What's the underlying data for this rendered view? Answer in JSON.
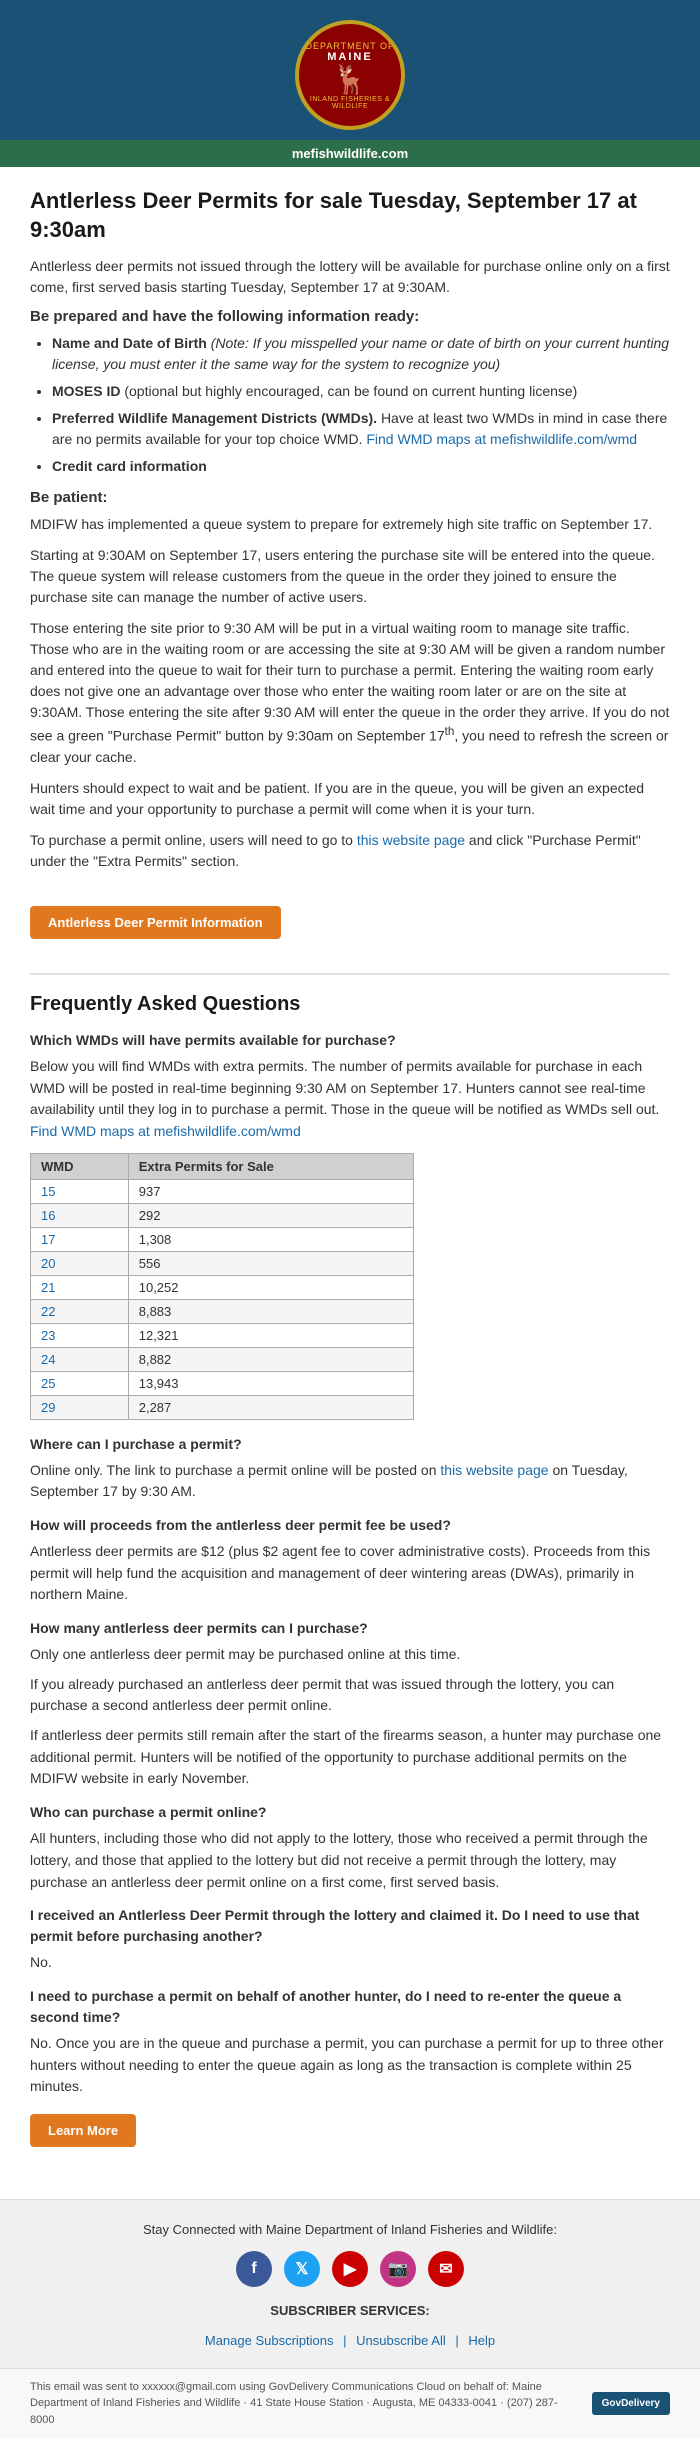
{
  "header": {
    "logo_top_text": "MAINE",
    "logo_arc_top": "DEPARTMENT OF",
    "logo_arc_bottom": "INLAND FISHERIES & WILDLIFE",
    "url_bar": "mefishwildlife.com"
  },
  "main": {
    "page_title": "Antlerless Deer Permits for sale Tuesday, September 17 at 9:30am",
    "intro_paragraph": "Antlerless deer permits not issued through the lottery will be available for purchase online only on a first come, first served basis starting Tuesday, September 17 at 9:30AM.",
    "be_prepared_heading": "Be prepared and have the following information ready:",
    "info_list": [
      {
        "label": "Name and Date of Birth",
        "note": "(Note: If you misspelled your name or date of birth on your current hunting license, you must enter it the same way for the system to recognize you)"
      },
      {
        "label": "MOSES ID",
        "note": "(optional but highly encouraged, can be found on current hunting license)"
      },
      {
        "label": "Preferred Wildlife Management Districts (WMDs).",
        "note": "Have at least two WMDs in mind in case there are no permits available for your top choice WMD.",
        "link_text": "Find WMD maps at mefishwildlife.com/wmd",
        "link_href": "#"
      },
      {
        "label": "Credit card information"
      }
    ],
    "be_patient_heading": "Be patient:",
    "be_patient_paragraphs": [
      "MDIFW has implemented a queue system to prepare for extremely high site traffic on September 17.",
      "Starting at 9:30AM on September 17, users entering the purchase site will be entered into the queue. The queue system will release customers from the queue in the order they joined to ensure the purchase site can manage the number of active users.",
      "Those entering the site prior to 9:30 AM will be put in a virtual waiting room to manage site traffic. Those who are in the waiting room or are accessing the site at 9:30 AM will be given a random number and entered into the queue to wait for their turn to purchase a permit. Entering the waiting room early does not give one an advantage over those who enter the waiting room later or are on the site at 9:30AM. Those entering the site after 9:30 AM will enter the queue in the order they arrive. If you do not see a green \"Purchase Permit\" button by 9:30am on September 17th, you need to refresh the screen or clear your cache.",
      "Hunters should expect to wait and be patient. If you are in the queue, you will be given an expected wait time and your opportunity to purchase a permit will come when it is your turn.",
      "To purchase a permit online, users will need to go to this website page and click \"Purchase Permit\" under the \"Extra Permits\" section."
    ],
    "btn_permit_info": "Antlerless Deer Permit Information",
    "faq_heading": "Frequently Asked Questions",
    "faqs": [
      {
        "question": "Which WMDs will have permits available for purchase?",
        "answer": "Below you will find WMDs with extra permits. The number of permits available for purchase in each WMD will be posted in real-time beginning 9:30 AM on September 17. Hunters cannot see real-time availability until they log in to purchase a permit. Those in the queue will be notified as WMDs sell out.",
        "link_text": "Find WMD maps at mefishwildlife.com/wmd",
        "link_href": "#",
        "has_table": true
      },
      {
        "question": "Where can I purchase a permit?",
        "answer": "Online only. The link to purchase a permit online will be posted on this website page on Tuesday, September 17 by 9:30 AM."
      },
      {
        "question": "How will proceeds from the antlerless deer permit fee be used?",
        "answer": "Antlerless deer permits are $12 (plus $2 agent fee to cover administrative costs). Proceeds from this permit will help fund the acquisition and management of deer wintering areas (DWAs), primarily in northern Maine."
      },
      {
        "question": "How many antlerless deer permits can I purchase?",
        "answer": "Only one antlerless deer permit may be purchased online at this time.",
        "answer2": "If you already purchased an antlerless deer permit that was issued through the lottery, you can purchase a second antlerless deer permit online.",
        "answer3": "If antlerless deer permits still remain after the start of the firearms season, a hunter may purchase one additional permit. Hunters will be notified of the opportunity to purchase additional permits on the MDIFW website in early November."
      },
      {
        "question": "Who can purchase a permit online?",
        "answer": "All hunters, including those who did not apply to the lottery, those who received a permit through the lottery, and those that applied to the lottery but did not receive a permit through the lottery, may purchase an antlerless deer permit online on a first come, first served basis."
      },
      {
        "question": "I received an Antlerless Deer Permit through the lottery and claimed it. Do I need to use that permit before purchasing another?",
        "answer": "No."
      },
      {
        "question": "I need to purchase a permit on behalf of another hunter, do I need to re-enter the queue a second time?",
        "answer": "No. Once you are in the queue and purchase a permit, you can purchase a permit for up to three other hunters without needing to enter the queue again as long as the transaction is complete within 25 minutes."
      }
    ],
    "table": {
      "col1_header": "WMD",
      "col2_header": "Extra Permits for Sale",
      "rows": [
        {
          "wmd": "15",
          "permits": "937"
        },
        {
          "wmd": "16",
          "permits": "292"
        },
        {
          "wmd": "17",
          "permits": "1,308"
        },
        {
          "wmd": "20",
          "permits": "556"
        },
        {
          "wmd": "21",
          "permits": "10,252"
        },
        {
          "wmd": "22",
          "permits": "8,883"
        },
        {
          "wmd": "23",
          "permits": "12,321"
        },
        {
          "wmd": "24",
          "permits": "8,882"
        },
        {
          "wmd": "25",
          "permits": "13,943"
        },
        {
          "wmd": "29",
          "permits": "2,287"
        }
      ]
    },
    "btn_learn_more": "Learn More"
  },
  "footer": {
    "social_heading": "Stay Connected with Maine Department of Inland Fisheries and Wildlife:",
    "subscriber_heading": "SUBSCRIBER SERVICES:",
    "subscriber_links": [
      {
        "label": "Manage Subscriptions",
        "href": "#"
      },
      {
        "label": "Unsubscribe All",
        "href": "#"
      },
      {
        "label": "Help",
        "href": "#"
      }
    ],
    "bottom_text": "This email was sent to xxxxxx@gmail.com using GovDelivery Communications Cloud on behalf of: Maine Department of Inland Fisheries and Wildlife · 41 State House Station · Augusta, ME 04333-0041 · (207) 287-8000",
    "govdelivery_label": "GovDelivery"
  }
}
